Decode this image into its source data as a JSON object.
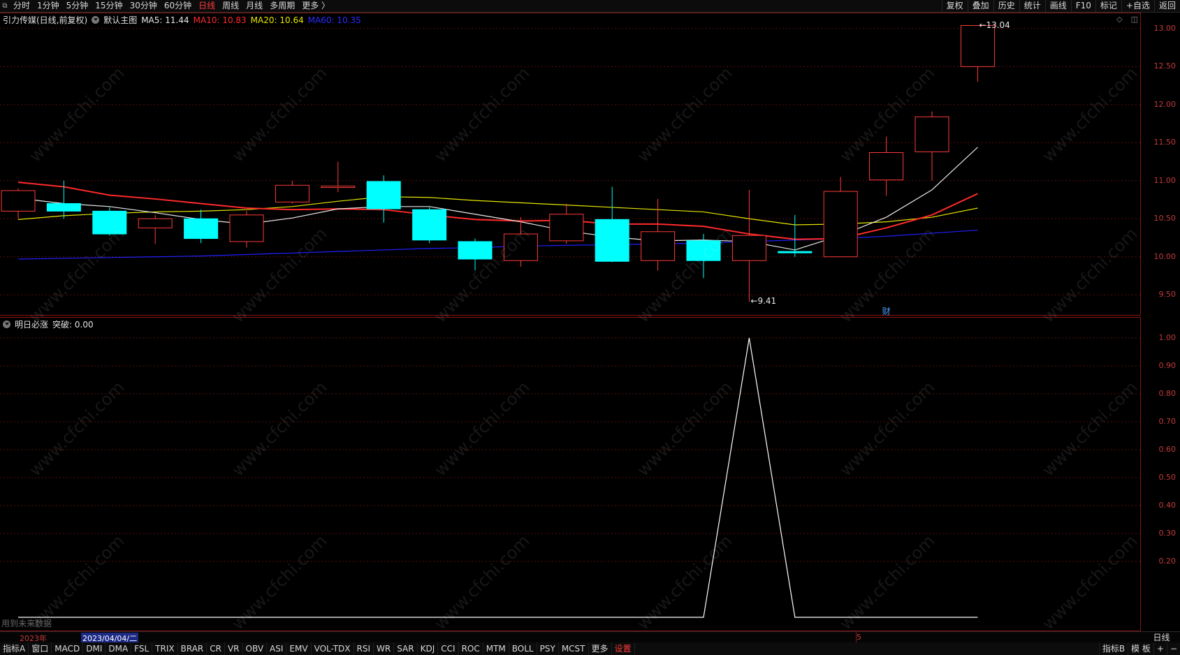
{
  "toolbar": {
    "periods": [
      "分时",
      "1分钟",
      "5分钟",
      "15分钟",
      "30分钟",
      "60分钟",
      "日线",
      "周线",
      "月线",
      "多周期",
      "更多 〉"
    ],
    "active_period": "日线",
    "right_buttons": [
      "复权",
      "叠加",
      "历史",
      "统计",
      "画线",
      "F10",
      "标记",
      "+自选",
      "返回"
    ]
  },
  "main_legend": {
    "title": "引力传媒(日线,前复权)",
    "template": "默认主图",
    "ma5": "MA5: 11.44",
    "ma10": "MA10: 10.83",
    "ma20": "MA20: 10.64",
    "ma60": "MA60: 10.35",
    "colors": {
      "ma5": "#e8e8e8",
      "ma10": "#ff2a2a",
      "ma20": "#e6e600",
      "ma60": "#2020ff"
    }
  },
  "sub_legend": {
    "title": "明日必涨",
    "value": "突破: 0.00"
  },
  "annotations": {
    "high": "13.04",
    "low": "9.41",
    "cai": "财",
    "future_note": "用到未来数据"
  },
  "date_bar": {
    "year": "2023年",
    "selected": "2023/04/04/二",
    "month_marker": "5",
    "period_button": "日线"
  },
  "main_axis_ticks": [
    "13.00",
    "12.50",
    "12.00",
    "11.50",
    "11.00",
    "10.50",
    "10.00",
    "9.50"
  ],
  "sub_axis_ticks": [
    "1.00",
    "0.90",
    "0.80",
    "0.70",
    "0.60",
    "0.50",
    "0.40",
    "0.30",
    "0.20"
  ],
  "bottom_tabs": [
    "指标A",
    "窗口",
    "MACD",
    "DMI",
    "DMA",
    "FSL",
    "TRIX",
    "BRAR",
    "CR",
    "VR",
    "OBV",
    "ASI",
    "EMV",
    "VOL-TDX",
    "RSI",
    "WR",
    "SAR",
    "KDJ",
    "CCI",
    "ROC",
    "MTM",
    "BOLL",
    "PSY",
    "MCST",
    "更多",
    "设置"
  ],
  "bottom_right": [
    "指标B",
    "模 板",
    "+",
    "−"
  ],
  "watermark": "www.cfchi.com",
  "colors": {
    "up": "#ff3b3b",
    "down": "#00ffff",
    "grid": "#3a0a0a",
    "axis": "#c23b3b"
  },
  "chart_data": {
    "type": "candlestick",
    "price_range": [
      9.3,
      13.1
    ],
    "candles": [
      {
        "o": 10.6,
        "c": 10.87,
        "h": 10.9,
        "l": 10.5
      },
      {
        "o": 10.7,
        "c": 10.6,
        "h": 11.0,
        "l": 10.5
      },
      {
        "o": 10.6,
        "c": 10.3,
        "h": 10.65,
        "l": 10.28
      },
      {
        "o": 10.38,
        "c": 10.5,
        "h": 10.55,
        "l": 10.17
      },
      {
        "o": 10.5,
        "c": 10.24,
        "h": 10.62,
        "l": 10.18
      },
      {
        "o": 10.2,
        "c": 10.55,
        "h": 10.6,
        "l": 10.12
      },
      {
        "o": 10.72,
        "c": 10.94,
        "h": 11.0,
        "l": 10.7
      },
      {
        "o": 10.91,
        "c": 10.93,
        "h": 11.25,
        "l": 10.85
      },
      {
        "o": 10.99,
        "c": 10.63,
        "h": 11.07,
        "l": 10.45
      },
      {
        "o": 10.62,
        "c": 10.22,
        "h": 10.65,
        "l": 10.18
      },
      {
        "o": 10.2,
        "c": 9.97,
        "h": 10.24,
        "l": 9.82
      },
      {
        "o": 9.95,
        "c": 10.3,
        "h": 10.52,
        "l": 9.87
      },
      {
        "o": 10.21,
        "c": 10.56,
        "h": 10.7,
        "l": 10.17
      },
      {
        "o": 10.49,
        "c": 9.94,
        "h": 10.92,
        "l": 9.93
      },
      {
        "o": 9.95,
        "c": 10.33,
        "h": 10.76,
        "l": 9.82
      },
      {
        "o": 10.21,
        "c": 9.95,
        "h": 10.3,
        "l": 9.72
      },
      {
        "o": 9.95,
        "c": 10.28,
        "h": 10.88,
        "l": 9.41
      },
      {
        "o": 10.07,
        "c": 10.06,
        "h": 10.55,
        "l": 10.0
      },
      {
        "o": 10.0,
        "c": 10.86,
        "h": 11.05,
        "l": 10.0
      },
      {
        "o": 11.01,
        "c": 11.37,
        "h": 11.58,
        "l": 10.8
      },
      {
        "o": 11.38,
        "c": 11.84,
        "h": 11.91,
        "l": 11.0
      },
      {
        "o": 12.5,
        "c": 13.04,
        "h": 13.04,
        "l": 12.3
      }
    ],
    "ma": {
      "ma5": [
        10.77,
        10.7,
        10.66,
        10.58,
        10.49,
        10.43,
        10.51,
        10.63,
        10.66,
        10.66,
        10.56,
        10.46,
        10.34,
        10.26,
        10.21,
        10.22,
        10.2,
        10.09,
        10.28,
        10.52,
        10.88,
        11.44
      ],
      "ma10": [
        10.98,
        10.92,
        10.81,
        10.76,
        10.7,
        10.64,
        10.62,
        10.63,
        10.62,
        10.55,
        10.49,
        10.47,
        10.48,
        10.43,
        10.43,
        10.4,
        10.3,
        10.23,
        10.24,
        10.38,
        10.55,
        10.83
      ],
      "ma20": [
        10.49,
        10.54,
        10.57,
        10.59,
        10.6,
        10.62,
        10.66,
        10.73,
        10.79,
        10.78,
        10.74,
        10.71,
        10.68,
        10.65,
        10.62,
        10.59,
        10.5,
        10.42,
        10.43,
        10.46,
        10.52,
        10.64
      ],
      "ma60": [
        9.97,
        9.98,
        9.99,
        10.0,
        10.01,
        10.03,
        10.05,
        10.07,
        10.09,
        10.11,
        10.12,
        10.14,
        10.15,
        10.16,
        10.17,
        10.18,
        10.2,
        10.22,
        10.24,
        10.27,
        10.31,
        10.35
      ]
    },
    "indicator": {
      "name": "突破",
      "range": [
        0,
        1.05
      ],
      "values": [
        0,
        0,
        0,
        0,
        0,
        0,
        0,
        0,
        0,
        0,
        0,
        0,
        0,
        0,
        0,
        0,
        1,
        0,
        0,
        0,
        0,
        0
      ]
    }
  }
}
